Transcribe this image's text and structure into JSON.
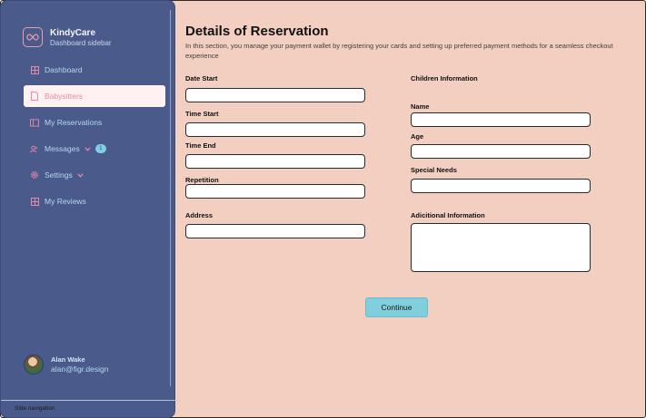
{
  "sidebar": {
    "brand": {
      "title": "KindyCare",
      "subtitle": "Dashboard sidebar",
      "icon": "infinity-icon"
    },
    "items": [
      {
        "label": "Dashboard",
        "icon": "grid-icon",
        "active": false
      },
      {
        "label": "Babysitters",
        "icon": "document-icon",
        "active": true
      },
      {
        "label": "My Reservations",
        "icon": "calendar-icon",
        "active": false
      },
      {
        "label": "Messages",
        "icon": "users-icon",
        "active": false,
        "badge": "1",
        "chevron": true
      },
      {
        "label": "Settings",
        "icon": "gear-icon",
        "active": false,
        "chevron": true
      },
      {
        "label": "My Reviews",
        "icon": "grid-icon",
        "active": false
      }
    ],
    "user": {
      "name": "Alan Wake",
      "email": "alan@figr.design"
    },
    "footer": "Side navigation"
  },
  "main": {
    "title": "Details of Reservation",
    "description": "In this section, you manage your payment wallet by registering your cards and setting up preferred payment methods for a seamless checkout experience",
    "left_fields": {
      "date_start": "Date Start",
      "time_start": "Time Start",
      "time_end": "Time End",
      "repetition": "Repetition",
      "address": "Address"
    },
    "right_section_title": "Children Information",
    "right_fields": {
      "name": "Name",
      "age": "Age",
      "special_needs": "Special Needs",
      "additional_info": "Adicitional Information"
    },
    "continue_label": "Continue"
  },
  "colors": {
    "background": "#f2cfc1",
    "sidebar": "#4a5a8a",
    "active_item_bg": "#fff1f1",
    "active_item_text": "#e68aa6",
    "nav_text": "#b8d8ee",
    "button": "#7fcfdc"
  }
}
